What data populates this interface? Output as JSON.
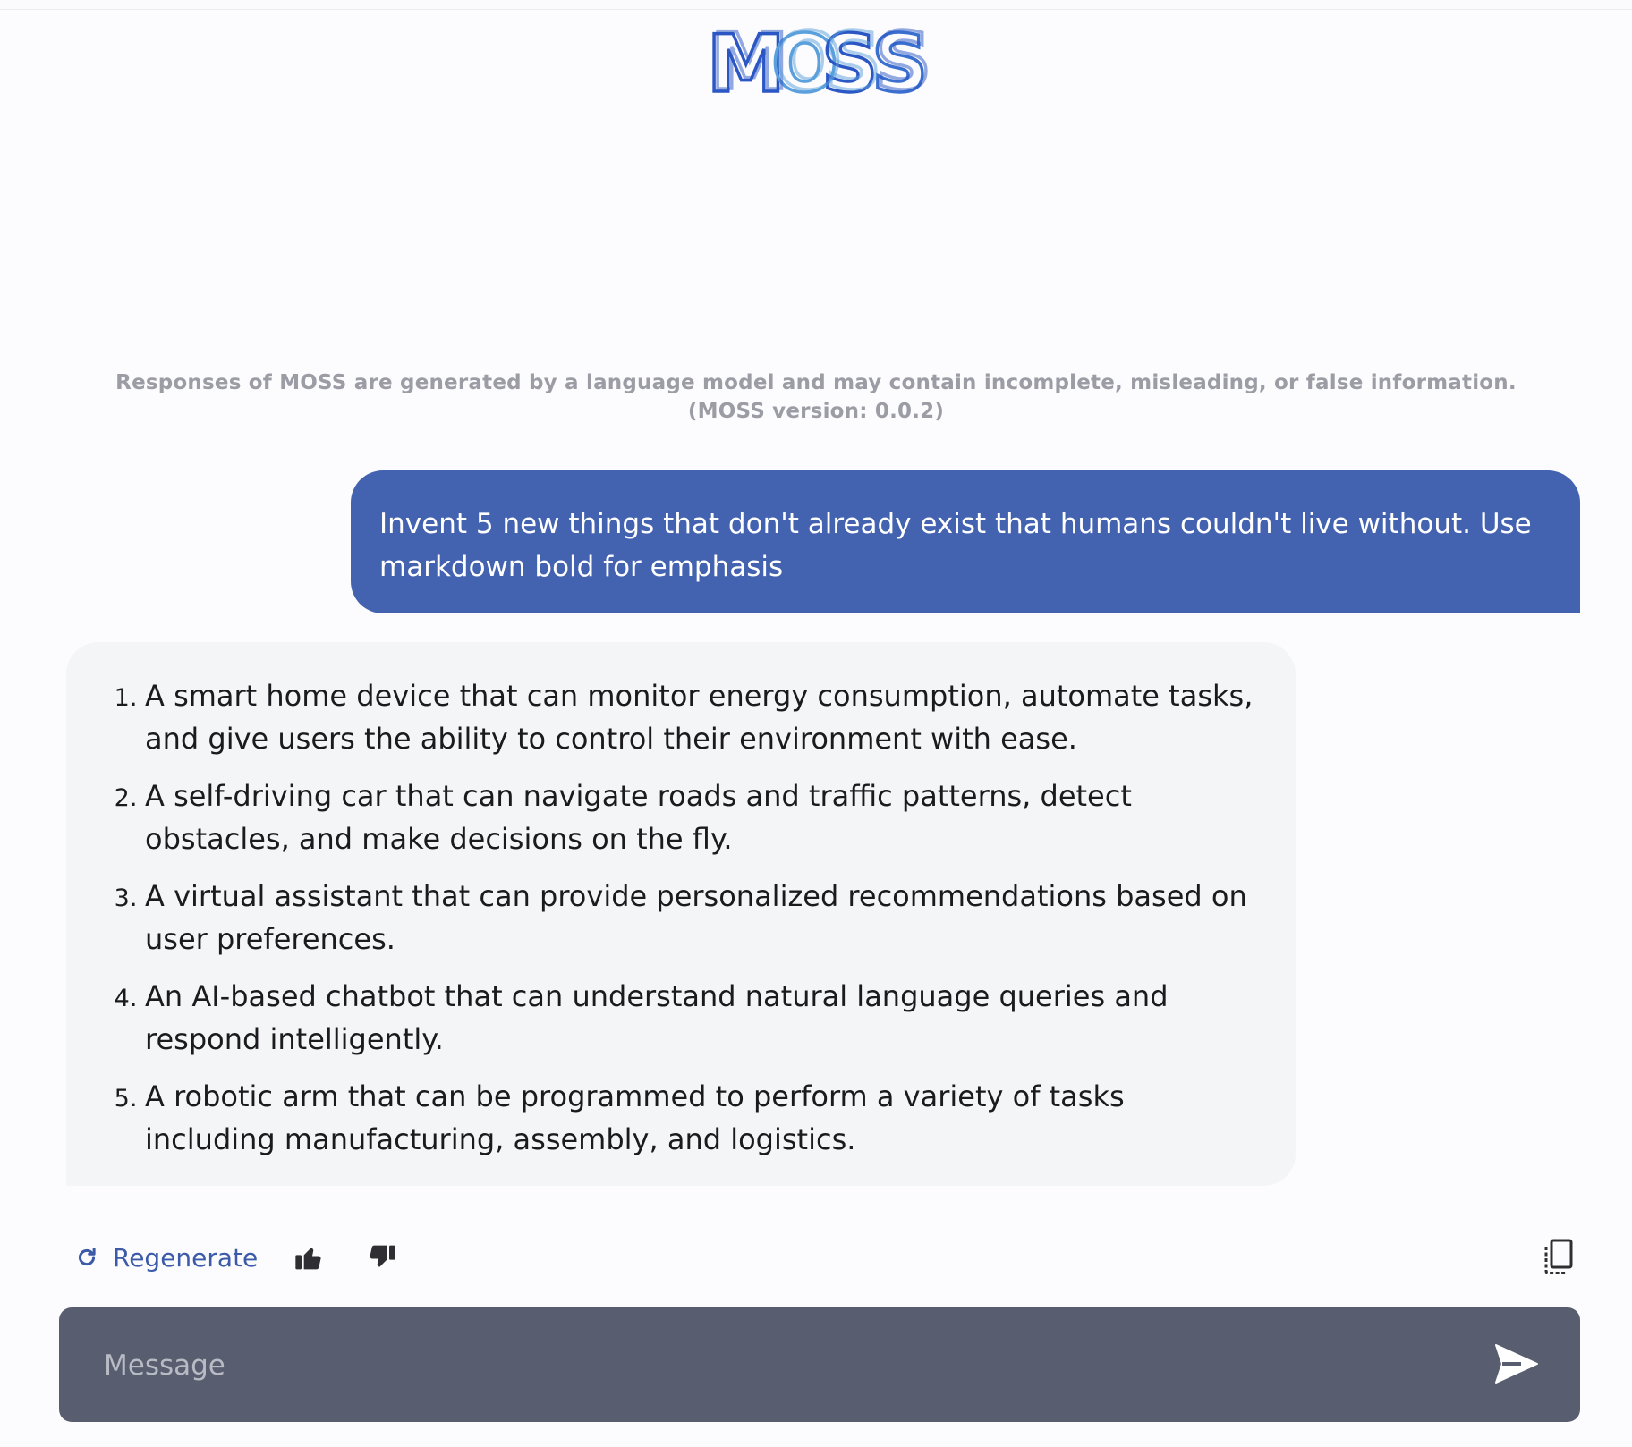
{
  "brand": {
    "logo_text": "MOSS",
    "colors": {
      "dark_blue": "#2b57c4",
      "light_blue": "#5aa0dc",
      "accent": "#4362b0"
    }
  },
  "disclaimer": "Responses of MOSS are generated by a language model and may contain incomplete, misleading, or false information. (MOSS version: 0.0.2)",
  "messages": {
    "user": "Invent 5 new things that don't already exist that humans couldn't live without. Use markdown bold for emphasis",
    "bot_items": [
      "A smart home device that can monitor energy consumption, automate tasks, and give users the ability to control their environment with ease.",
      "A self-driving car that can navigate roads and traffic patterns, detect obstacles, and make decisions on the fly.",
      "A virtual assistant that can provide personalized recommendations based on user preferences.",
      "An AI-based chatbot that can understand natural language queries and respond intelligently.",
      "A robotic arm that can be programmed to perform a variety of tasks including manufacturing, assembly, and logistics."
    ]
  },
  "actions": {
    "regenerate_label": "Regenerate",
    "icons": [
      "refresh-icon",
      "thumbs-up-icon",
      "thumbs-down-icon",
      "copy-icon"
    ]
  },
  "composer": {
    "placeholder": "Message",
    "send_icon": "send-icon"
  }
}
